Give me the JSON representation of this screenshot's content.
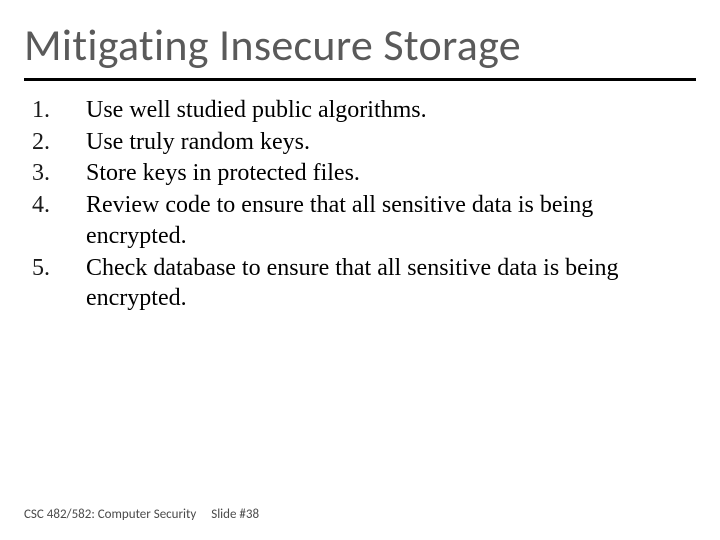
{
  "title": "Mitigating Insecure Storage",
  "items": [
    {
      "num": "1.",
      "text": "Use well studied public algorithms."
    },
    {
      "num": "2.",
      "text": "Use truly random keys."
    },
    {
      "num": "3.",
      "text": "Store keys in protected files."
    },
    {
      "num": "4.",
      "text": "Review code to ensure that all sensitive data is being encrypted."
    },
    {
      "num": "5.",
      "text": "Check database to ensure that all sensitive data is being encrypted."
    }
  ],
  "footer": {
    "course": "CSC 482/582: Computer Security",
    "slide": "Slide #38"
  }
}
